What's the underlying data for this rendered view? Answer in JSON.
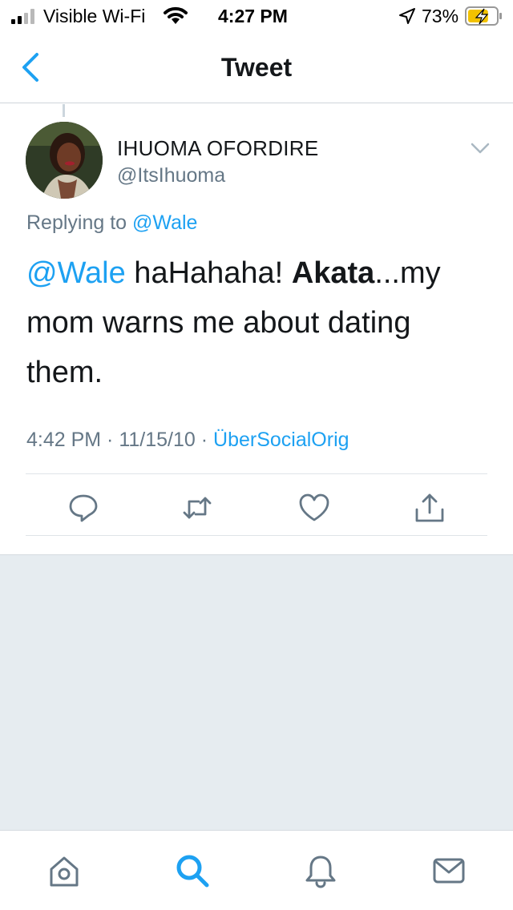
{
  "status_bar": {
    "carrier": "Visible Wi-Fi",
    "time": "4:27 PM",
    "battery_percent": "73%",
    "battery_level": 0.73,
    "icons": [
      "signal-icon",
      "wifi-icon",
      "location-arrow-icon",
      "battery-charging-icon"
    ]
  },
  "nav": {
    "title": "Tweet",
    "back_icon": "chevron-left-icon"
  },
  "tweet": {
    "author_name": "IHUOMA OFORDIRE",
    "author_handle": "@ItsIhuoma",
    "replying_prefix": "Replying to ",
    "replying_to": "@Wale",
    "text_mention": "@Wale",
    "text_part1": " haHahaha! ",
    "text_bold": "Akata",
    "text_part2": "...my mom warns me about dating them.",
    "time": "4:42 PM",
    "separator": " · ",
    "date": "11/15/10",
    "source": "ÜberSocialOrig",
    "actions": [
      "reply-icon",
      "retweet-icon",
      "like-icon",
      "share-icon"
    ]
  },
  "tab_bar": {
    "tabs": [
      "home-icon",
      "search-icon",
      "notifications-icon",
      "messages-icon"
    ],
    "active_tab": "search-icon"
  },
  "colors": {
    "accent": "#1da1f2",
    "secondary_text": "#657786",
    "primary_text": "#14171a",
    "background_gray": "#e6ecf0",
    "icon_gray": "#657786"
  }
}
